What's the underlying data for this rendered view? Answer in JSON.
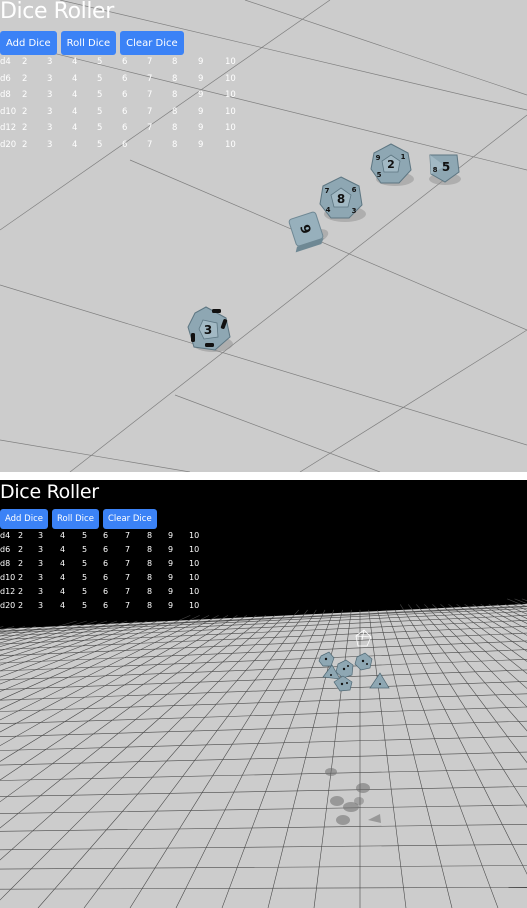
{
  "app": {
    "title": "Dice Roller",
    "buttons": {
      "add": "Add Dice",
      "roll": "Roll Dice",
      "clear": "Clear Dice"
    }
  },
  "table": {
    "rows": [
      {
        "label": "d4",
        "values": [
          "2",
          "3",
          "4",
          "5",
          "6",
          "7",
          "8",
          "9",
          "10"
        ]
      },
      {
        "label": "d6",
        "values": [
          "2",
          "3",
          "4",
          "5",
          "6",
          "7",
          "8",
          "9",
          "10"
        ]
      },
      {
        "label": "d8",
        "values": [
          "2",
          "3",
          "4",
          "5",
          "6",
          "7",
          "8",
          "9",
          "10"
        ]
      },
      {
        "label": "d10",
        "values": [
          "2",
          "3",
          "4",
          "5",
          "6",
          "7",
          "8",
          "9",
          "10"
        ]
      },
      {
        "label": "d12",
        "values": [
          "2",
          "3",
          "4",
          "5",
          "6",
          "7",
          "8",
          "9",
          "10"
        ]
      },
      {
        "label": "d20",
        "values": [
          "2",
          "3",
          "4",
          "5",
          "6",
          "7",
          "8",
          "9",
          "10"
        ]
      }
    ]
  },
  "scene_top": {
    "dice": [
      {
        "type": "d6",
        "face": "9"
      },
      {
        "type": "d12",
        "face": "8"
      },
      {
        "type": "d12",
        "face": "2"
      },
      {
        "type": "d8",
        "face": "5"
      },
      {
        "type": "d10",
        "face": "3"
      }
    ]
  },
  "colors": {
    "button": "#3b82f6",
    "floor": "#cccccc",
    "die": "#8ea7b3",
    "pips": "#111111",
    "text": "#ffffff",
    "background_dark": "#000000"
  }
}
